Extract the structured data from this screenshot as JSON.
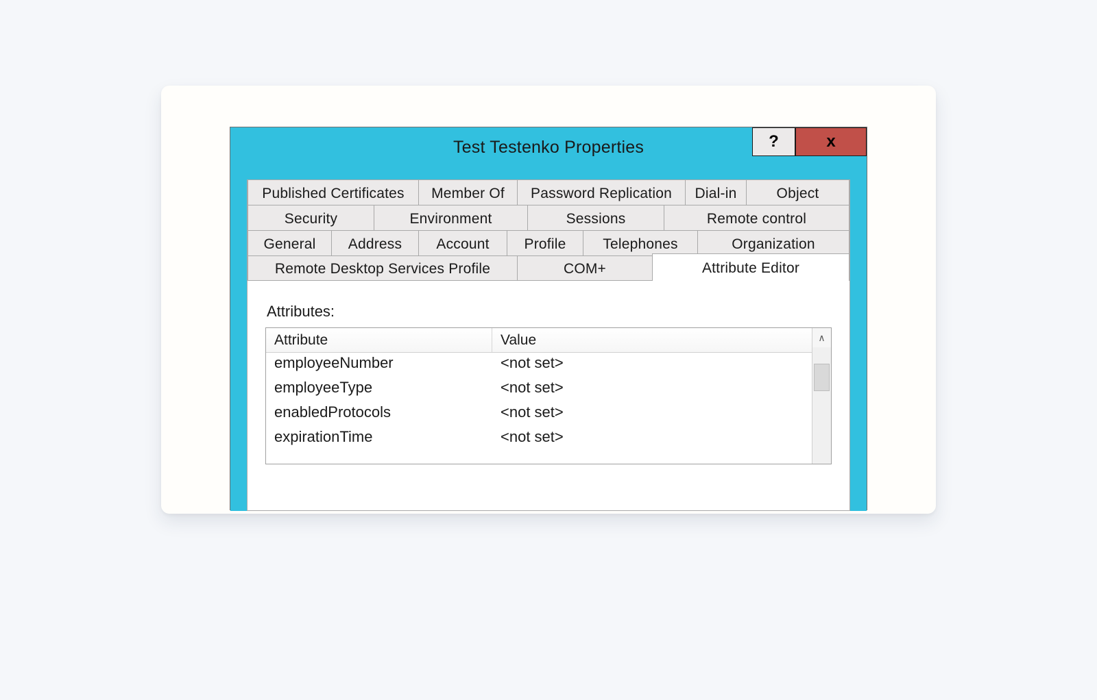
{
  "window": {
    "title": "Test Testenko Properties",
    "help_symbol": "?",
    "close_symbol": "x"
  },
  "tabs": {
    "row1": [
      "Published Certificates",
      "Member Of",
      "Password Replication",
      "Dial-in",
      "Object"
    ],
    "row2": [
      "Security",
      "Environment",
      "Sessions",
      "Remote control"
    ],
    "row3": [
      "General",
      "Address",
      "Account",
      "Profile",
      "Telephones",
      "Organization"
    ],
    "row4": [
      "Remote Desktop Services Profile",
      "COM+",
      "Attribute Editor"
    ],
    "active": "Attribute Editor"
  },
  "panel": {
    "label": "Attributes:",
    "columns": {
      "attribute": "Attribute",
      "value": "Value"
    },
    "rows": [
      {
        "attribute": "employeeNumber",
        "value": "<not set>"
      },
      {
        "attribute": "employeeType",
        "value": "<not set>"
      },
      {
        "attribute": "enabledProtocols",
        "value": "<not set>"
      },
      {
        "attribute": "expirationTime",
        "value": "<not set>"
      }
    ],
    "scroll_up_glyph": "∧"
  }
}
